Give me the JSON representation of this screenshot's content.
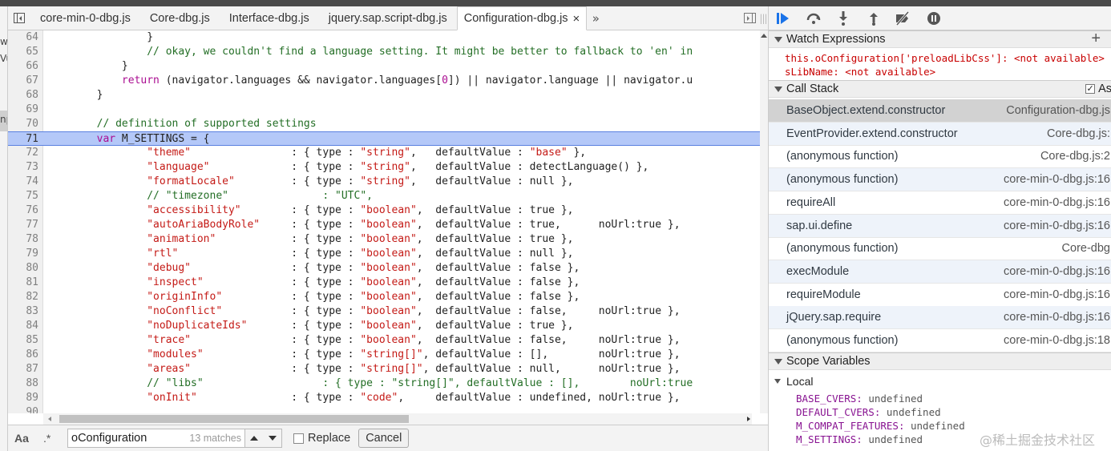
{
  "left_strip": {
    "frag1": "w",
    "frag2": "Vu",
    "frag3": "np"
  },
  "tabs": [
    {
      "label": "core-min-0-dbg.js",
      "active": false
    },
    {
      "label": "Core-dbg.js",
      "active": false
    },
    {
      "label": "Interface-dbg.js",
      "active": false
    },
    {
      "label": "jquery.sap.script-dbg.js",
      "active": false
    },
    {
      "label": "Configuration-dbg.js",
      "active": true
    }
  ],
  "tab_close": "×",
  "tab_more": "»",
  "code_lines": [
    {
      "num": "64",
      "parts": [
        [
          "p",
          "                }"
        ]
      ]
    },
    {
      "num": "65",
      "parts": [
        [
          "c",
          "                // okay, we couldn't find a language setting. It might be better to fallback to 'en' in"
        ]
      ]
    },
    {
      "num": "66",
      "parts": [
        [
          "p",
          "            }"
        ]
      ]
    },
    {
      "num": "67",
      "parts": [
        [
          "p",
          "            "
        ],
        [
          "k",
          "return"
        ],
        [
          "p",
          " (navigator.languages && navigator.languages["
        ],
        [
          "k",
          "0"
        ],
        [
          "p",
          "]) || navigator.language || navigator.u"
        ]
      ]
    },
    {
      "num": "68",
      "parts": [
        [
          "p",
          "        }"
        ]
      ]
    },
    {
      "num": "69",
      "parts": [
        [
          "p",
          ""
        ]
      ]
    },
    {
      "num": "70",
      "parts": [
        [
          "c",
          "        // definition of supported settings"
        ]
      ]
    },
    {
      "num": "71",
      "highlight": true,
      "parts": [
        [
          "p",
          "        "
        ],
        [
          "k",
          "var"
        ],
        [
          "p",
          " M_SETTINGS = {"
        ]
      ]
    },
    {
      "num": "72",
      "parts": [
        [
          "s",
          "                \"theme\""
        ],
        [
          "p",
          "                : { type : "
        ],
        [
          "s",
          "\"string\""
        ],
        [
          "p",
          ",   defaultValue : "
        ],
        [
          "s",
          "\"base\""
        ],
        [
          "p",
          " },"
        ]
      ]
    },
    {
      "num": "73",
      "parts": [
        [
          "s",
          "                \"language\""
        ],
        [
          "p",
          "             : { type : "
        ],
        [
          "s",
          "\"string\""
        ],
        [
          "p",
          ",   defaultValue : detectLanguage() },"
        ]
      ]
    },
    {
      "num": "74",
      "parts": [
        [
          "s",
          "                \"formatLocale\""
        ],
        [
          "p",
          "         : { type : "
        ],
        [
          "s",
          "\"string\""
        ],
        [
          "p",
          ",   defaultValue : null },"
        ]
      ]
    },
    {
      "num": "75",
      "parts": [
        [
          "c",
          "                // \"timezone\"               : \"UTC\","
        ]
      ]
    },
    {
      "num": "76",
      "parts": [
        [
          "s",
          "                \"accessibility\""
        ],
        [
          "p",
          "        : { type : "
        ],
        [
          "s",
          "\"boolean\""
        ],
        [
          "p",
          ",  defaultValue : true },"
        ]
      ]
    },
    {
      "num": "77",
      "parts": [
        [
          "s",
          "                \"autoAriaBodyRole\""
        ],
        [
          "p",
          "     : { type : "
        ],
        [
          "s",
          "\"boolean\""
        ],
        [
          "p",
          ",  defaultValue : true,      noUrl:true },"
        ]
      ]
    },
    {
      "num": "78",
      "parts": [
        [
          "s",
          "                \"animation\""
        ],
        [
          "p",
          "            : { type : "
        ],
        [
          "s",
          "\"boolean\""
        ],
        [
          "p",
          ",  defaultValue : true },"
        ]
      ]
    },
    {
      "num": "79",
      "parts": [
        [
          "s",
          "                \"rtl\""
        ],
        [
          "p",
          "                  : { type : "
        ],
        [
          "s",
          "\"boolean\""
        ],
        [
          "p",
          ",  defaultValue : null },"
        ]
      ]
    },
    {
      "num": "80",
      "parts": [
        [
          "s",
          "                \"debug\""
        ],
        [
          "p",
          "                : { type : "
        ],
        [
          "s",
          "\"boolean\""
        ],
        [
          "p",
          ",  defaultValue : false },"
        ]
      ]
    },
    {
      "num": "81",
      "parts": [
        [
          "s",
          "                \"inspect\""
        ],
        [
          "p",
          "              : { type : "
        ],
        [
          "s",
          "\"boolean\""
        ],
        [
          "p",
          ",  defaultValue : false },"
        ]
      ]
    },
    {
      "num": "82",
      "parts": [
        [
          "s",
          "                \"originInfo\""
        ],
        [
          "p",
          "           : { type : "
        ],
        [
          "s",
          "\"boolean\""
        ],
        [
          "p",
          ",  defaultValue : false },"
        ]
      ]
    },
    {
      "num": "83",
      "parts": [
        [
          "s",
          "                \"noConflict\""
        ],
        [
          "p",
          "           : { type : "
        ],
        [
          "s",
          "\"boolean\""
        ],
        [
          "p",
          ",  defaultValue : false,     noUrl:true },"
        ]
      ]
    },
    {
      "num": "84",
      "parts": [
        [
          "s",
          "                \"noDuplicateIds\""
        ],
        [
          "p",
          "       : { type : "
        ],
        [
          "s",
          "\"boolean\""
        ],
        [
          "p",
          ",  defaultValue : true },"
        ]
      ]
    },
    {
      "num": "85",
      "parts": [
        [
          "s",
          "                \"trace\""
        ],
        [
          "p",
          "                : { type : "
        ],
        [
          "s",
          "\"boolean\""
        ],
        [
          "p",
          ",  defaultValue : false,     noUrl:true },"
        ]
      ]
    },
    {
      "num": "86",
      "parts": [
        [
          "s",
          "                \"modules\""
        ],
        [
          "p",
          "              : { type : "
        ],
        [
          "s",
          "\"string[]\""
        ],
        [
          "p",
          ", defaultValue : [],        noUrl:true },"
        ]
      ]
    },
    {
      "num": "87",
      "parts": [
        [
          "s",
          "                \"areas\""
        ],
        [
          "p",
          "                : { type : "
        ],
        [
          "s",
          "\"string[]\""
        ],
        [
          "p",
          ", defaultValue : null,      noUrl:true },"
        ]
      ]
    },
    {
      "num": "88",
      "parts": [
        [
          "c",
          "                // \"libs\"                   : { type : \"string[]\", defaultValue : [],        noUrl:true"
        ]
      ]
    },
    {
      "num": "89",
      "parts": [
        [
          "s",
          "                \"onInit\""
        ],
        [
          "p",
          "               : { type : "
        ],
        [
          "s",
          "\"code\""
        ],
        [
          "p",
          ",     defaultValue : undefined, noUrl:true },"
        ]
      ]
    },
    {
      "num": "90",
      "parts": [
        [
          "p",
          ""
        ]
      ]
    }
  ],
  "search": {
    "case_label": "Aa",
    "regex_label": ".*",
    "query": "oConfiguration",
    "match_count": "13 matches",
    "replace_label": "Replace",
    "cancel_label": "Cancel"
  },
  "watch": {
    "header": "Watch Expressions",
    "add_symbol": "+",
    "items": [
      {
        "expr": "this.oConfiguration['preloadLibCss']",
        "value": "<not available>"
      },
      {
        "expr": "sLibName",
        "value": "<not available>"
      }
    ]
  },
  "callstack": {
    "header": "Call Stack",
    "async_label": "As",
    "frames": [
      {
        "fn": "BaseObject.extend.constructor",
        "loc": "Configuration-dbg.js"
      },
      {
        "fn": "EventProvider.extend.constructor",
        "loc": "Core-dbg.js:"
      },
      {
        "fn": "(anonymous function)",
        "loc": "Core-dbg.js:2"
      },
      {
        "fn": "(anonymous function)",
        "loc": "core-min-0-dbg.js:16"
      },
      {
        "fn": "requireAll",
        "loc": "core-min-0-dbg.js:16"
      },
      {
        "fn": "sap.ui.define",
        "loc": "core-min-0-dbg.js:16"
      },
      {
        "fn": "(anonymous function)",
        "loc": "Core-dbg"
      },
      {
        "fn": "execModule",
        "loc": "core-min-0-dbg.js:16"
      },
      {
        "fn": "requireModule",
        "loc": "core-min-0-dbg.js:16"
      },
      {
        "fn": "jQuery.sap.require",
        "loc": "core-min-0-dbg.js:16"
      },
      {
        "fn": "(anonymous function)",
        "loc": "core-min-0-dbg.js:18"
      }
    ]
  },
  "scope": {
    "header": "Scope Variables",
    "local_label": "Local",
    "vars": [
      {
        "name": "BASE_CVERS",
        "value": "undefined"
      },
      {
        "name": "DEFAULT_CVERS",
        "value": "undefined"
      },
      {
        "name": "M_COMPAT_FEATURES",
        "value": "undefined"
      },
      {
        "name": "M_SETTINGS",
        "value": "undefined"
      }
    ]
  },
  "watermark": "@稀土掘金技术社区",
  "colors": {
    "highlight": "#b4c8f8",
    "string": "#c41a16",
    "comment": "#236e25",
    "keyword": "#aa0d91",
    "debug_blue": "#1a73e8"
  }
}
